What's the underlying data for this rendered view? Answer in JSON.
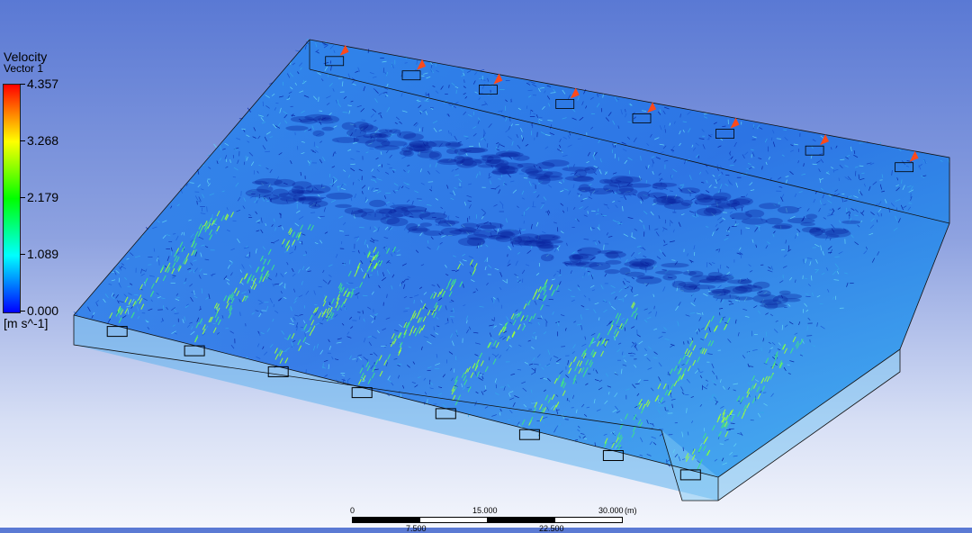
{
  "legend": {
    "title": "Velocity",
    "subtitle": "Vector 1",
    "max": "4.357",
    "v3": "3.268",
    "v2": "2.179",
    "v1": "1.089",
    "min": "0.000",
    "unit": "[m s^-1]",
    "colors": [
      "#ff0000",
      "#ff8000",
      "#ffff00",
      "#80ff00",
      "#00ff00",
      "#00ff80",
      "#00ffff",
      "#0080ff",
      "#0000ff"
    ]
  },
  "scale": {
    "t0": "0",
    "t15": "15.000",
    "t30": "30.000",
    "unit": "(m)",
    "t7": "7.500",
    "t22": "22.500"
  }
}
